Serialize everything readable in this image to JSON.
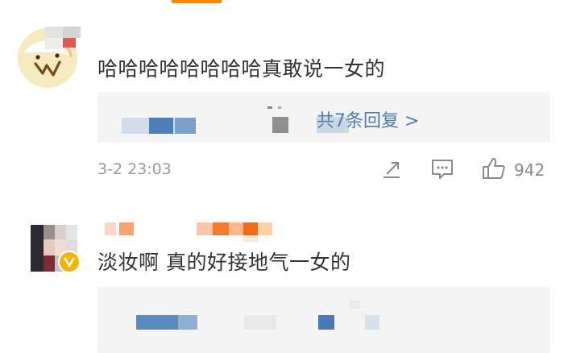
{
  "comments": [
    {
      "text": "哈哈哈哈哈哈哈哈真敢说一女的",
      "replies_link": "共7条回复 >",
      "time": "3-2 23:03",
      "likes": "942",
      "avatar_icon": "avatar-cartoon-icon"
    },
    {
      "text": "淡妆啊 真的好接地气一女的",
      "avatar_icon": "avatar-photo-icon",
      "verified_icon": "verified-badge-icon"
    }
  ],
  "colors": {
    "accent": "#ff8200",
    "link": "#507daf",
    "text": "#333333",
    "meta": "#9a9a9a",
    "reply_bg": "#f4f4f4",
    "verified": "#f6b400"
  }
}
